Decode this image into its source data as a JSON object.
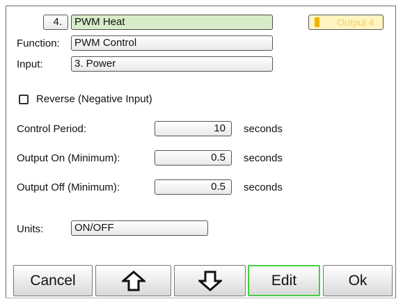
{
  "header": {
    "index": "4.",
    "name": "PWM Heat",
    "badge_text": "Output 4"
  },
  "function": {
    "label": "Function:",
    "value": "PWM Control"
  },
  "input": {
    "label": "Input:",
    "value": "3. Power"
  },
  "reverse": {
    "label": "Reverse (Negative Input)",
    "checked": false
  },
  "control_period": {
    "label": "Control Period:",
    "value": "10",
    "unit": "seconds"
  },
  "output_on": {
    "label": "Output On (Minimum):",
    "value": "0.5",
    "unit": "seconds"
  },
  "output_off": {
    "label": "Output Off (Minimum):",
    "value": "0.5",
    "unit": "seconds"
  },
  "units": {
    "label": "Units:",
    "value": "ON/OFF"
  },
  "buttons": {
    "cancel": "Cancel",
    "up_icon": "arrow-up-icon",
    "down_icon": "arrow-down-icon",
    "edit": "Edit",
    "ok": "Ok"
  },
  "colors": {
    "highlight_field": "#d7edc9",
    "edit_border": "#44cc44",
    "badge_fill": "#fff5c2",
    "badge_bar": "#f0b400"
  }
}
